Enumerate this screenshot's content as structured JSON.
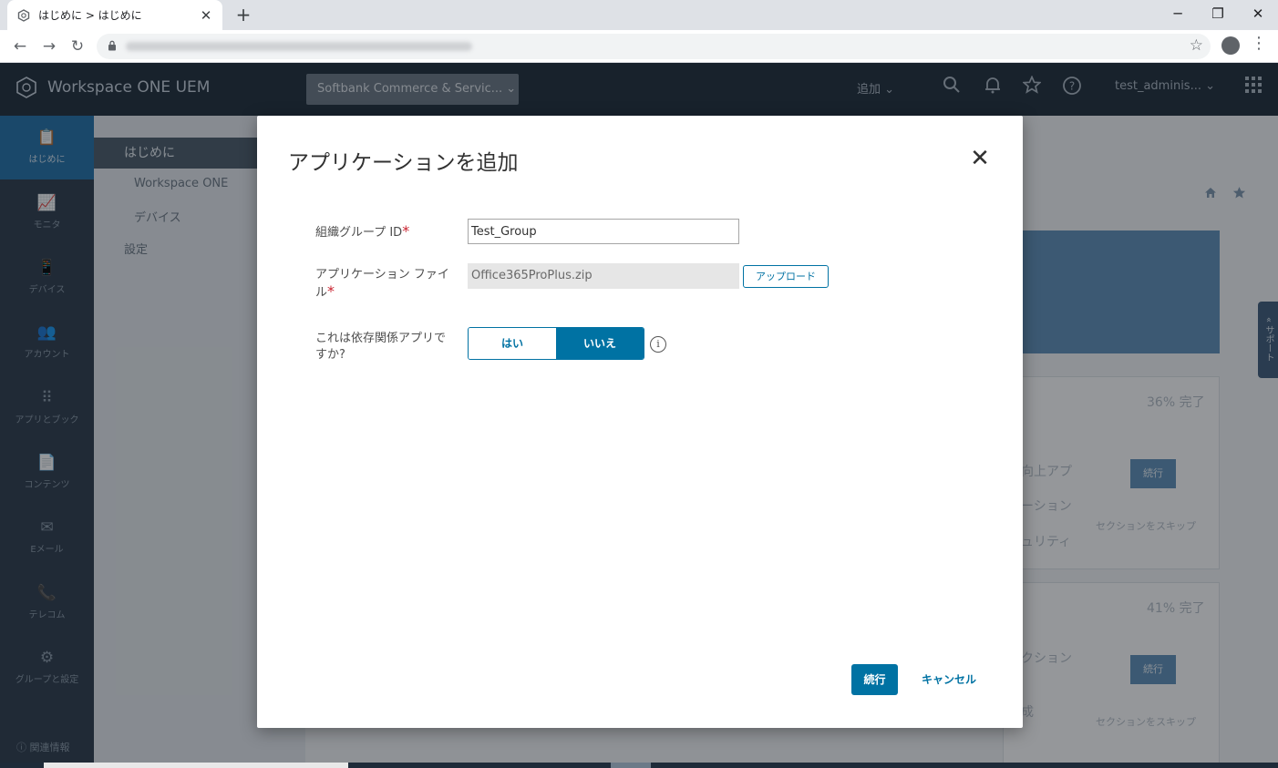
{
  "browser": {
    "tab_title": "はじめに > はじめに",
    "tab_close": "✕",
    "new_tab": "+",
    "minimize": "─",
    "restore": "❐",
    "close": "✕",
    "back": "←",
    "forward": "→",
    "reload": "↻",
    "bookmark": "☆",
    "menu": "⋮"
  },
  "app": {
    "brand": "Workspace ONE UEM",
    "org_group": "Softbank Commerce & Servic... ⌄",
    "add_menu": "追加 ⌄",
    "user": "test_adminis... ⌄",
    "rail": [
      {
        "label": "はじめに",
        "icon": "📋"
      },
      {
        "label": "モニタ",
        "icon": "📈"
      },
      {
        "label": "デバイス",
        "icon": "📱"
      },
      {
        "label": "アカウント",
        "icon": "👥"
      },
      {
        "label": "アプリとブック",
        "icon": "⠿"
      },
      {
        "label": "コンテンツ",
        "icon": "📄"
      },
      {
        "label": "Eメール",
        "icon": "✉"
      },
      {
        "label": "テレコム",
        "icon": "📞"
      },
      {
        "label": "グループと設定",
        "icon": "⚙"
      }
    ],
    "rail_footer": "ⓘ 関連情報",
    "subnav": {
      "active": "はじめに",
      "item1": "Workspace ONE",
      "item2": "デバイス",
      "item3": "設定"
    },
    "bg_progress1": "36% 完了",
    "bg_progress2": "41% 完了",
    "bg_continue": "続行",
    "bg_skip": "セクションをスキップ",
    "bg_line1": "向上アプ",
    "bg_line2": "ーション",
    "bg_line3": "ュリティ",
    "bg_line4": "クション",
    "bg_line5": "成",
    "support": "« サポート"
  },
  "modal": {
    "title": "アプリケーションを追加",
    "close": "✕",
    "org_group_label": "組織グループ ID",
    "org_group_value": "Test_Group",
    "app_file_label": "アプリケーション ファイル",
    "app_file_value": "Office365ProPlus.zip",
    "upload": "アップロード",
    "dependency_label": "これは依存関係アプリですか?",
    "yes": "はい",
    "no": "いいえ",
    "selected": "いいえ",
    "info": "i",
    "required_mark": "*",
    "continue": "続行",
    "cancel": "キャンセル"
  },
  "colors": {
    "primary": "#0072a3",
    "required": "#c9222f",
    "header": "#1d2a38"
  }
}
